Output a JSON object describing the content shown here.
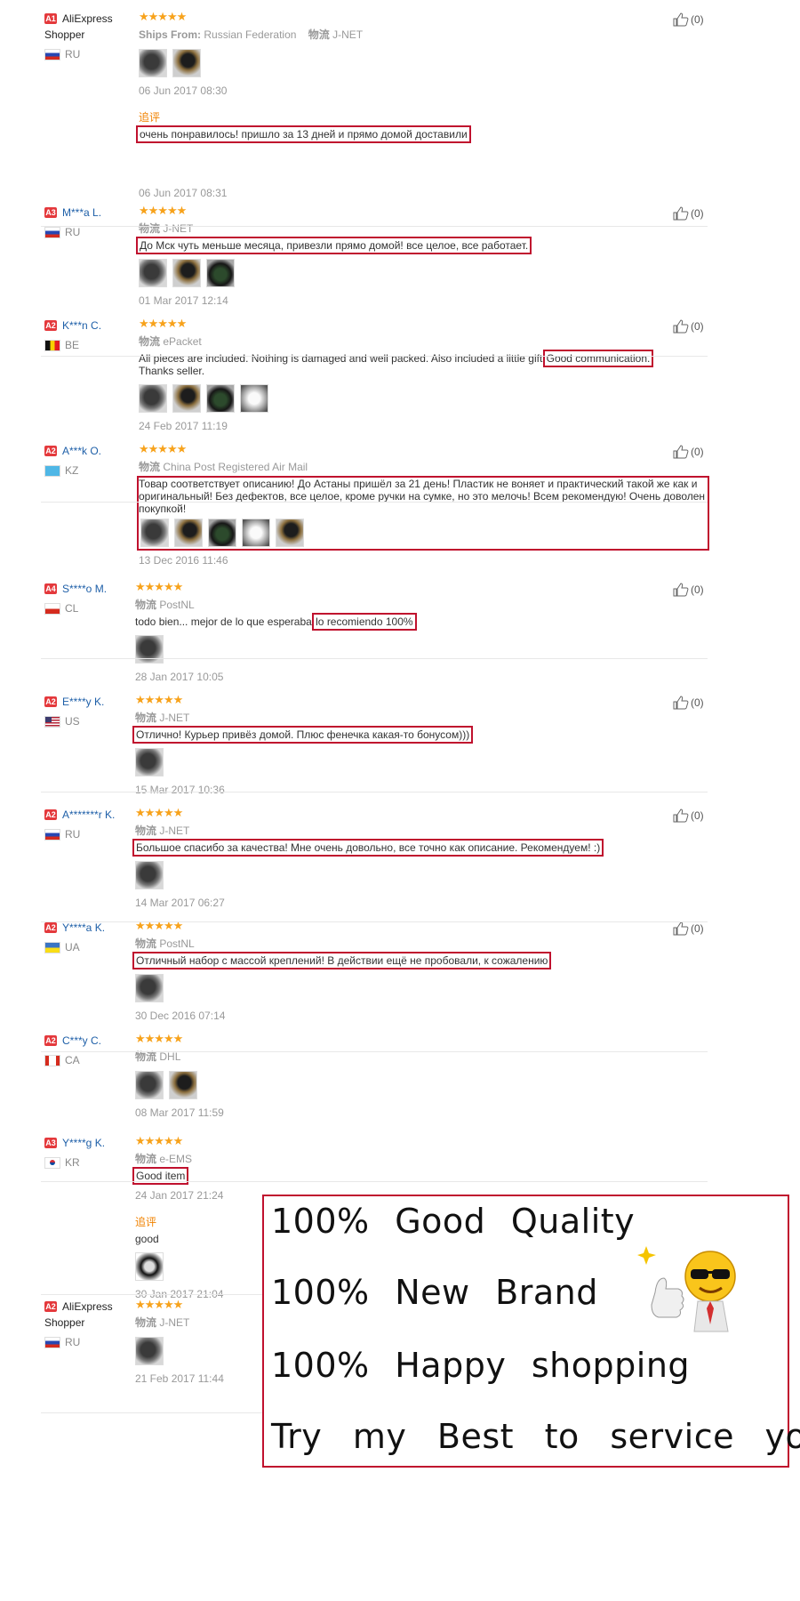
{
  "reviews": [
    {
      "level": "A1",
      "name": "AliExpress Shopper",
      "shopper": true,
      "country": "RU",
      "flag": "ru",
      "stars": "★★★★★",
      "ships_label": "Ships From:",
      "ships_value": "Russian Federation",
      "logistics_label": "物流",
      "logistics": "J-NET",
      "text": "",
      "text_boxed": "",
      "photos": 2,
      "date": "06 Jun 2017 08:30",
      "additional_label": "追评",
      "additional_text": "очень понравилось! пришло за 13 дней и прямо домой доставили",
      "additional_date": "06 Jun 2017 08:31",
      "likes": "(0)"
    },
    {
      "level": "A3",
      "name": "M***a L.",
      "country": "RU",
      "flag": "ru",
      "stars": "★★★★★",
      "logistics_label": "物流",
      "logistics": "J-NET",
      "text": "",
      "text_boxed": "До Мск чуть меньше месяца, привезли прямо домой! все целое, все работает.",
      "photos": 3,
      "date": "01 Mar 2017 12:14",
      "likes": "(0)"
    },
    {
      "level": "A2",
      "name": "K***n C.",
      "country": "BE",
      "flag": "be",
      "stars": "★★★★★",
      "logistics_label": "物流",
      "logistics": "ePacket",
      "text": "All pieces are included. Nothing is damaged and well packed. Also included a little gift.",
      "text_boxed": "Good communication.",
      "text_after": "Thanks seller.",
      "photos": 4,
      "date": "24 Feb 2017 11:19",
      "likes": "(0)"
    },
    {
      "level": "A2",
      "name": "A***k O.",
      "country": "KZ",
      "flag": "kz",
      "stars": "★★★★★",
      "logistics_label": "物流",
      "logistics": "China Post Registered Air Mail",
      "text": "",
      "text_boxed": "Товар соответствует описанию! До Астаны пришёл за 21 день! Пластик не воняет и практический такой же как и оригинальный! Без дефектов, все целое, кроме ручки на сумке, но это мелочь! Всем рекомендую! Очень доволен покупкой!",
      "photos": 5,
      "date": "13 Dec 2016 11:46",
      "likes": "(0)"
    },
    {
      "level": "A4",
      "name": "S****o M.",
      "country": "CL",
      "flag": "cl",
      "stars": "★★★★★",
      "logistics_label": "物流",
      "logistics": "PostNL",
      "text": "todo bien... mejor de lo que esperaba,",
      "text_boxed": "lo recomiendo 100%",
      "photos": 1,
      "date": "28 Jan 2017 10:05",
      "likes": "(0)"
    },
    {
      "level": "A2",
      "name": "E****y K.",
      "country": "US",
      "flag": "us",
      "stars": "★★★★★",
      "logistics_label": "物流",
      "logistics": "J-NET",
      "text": "",
      "text_boxed": "Отлично! Курьер привёз домой. Плюс фенечка какая-то бонусом)))",
      "photos": 1,
      "date": "15 Mar 2017 10:36",
      "likes": "(0)"
    },
    {
      "level": "A2",
      "name": "A*******r K.",
      "country": "RU",
      "flag": "ru",
      "stars": "★★★★★",
      "logistics_label": "物流",
      "logistics": "J-NET",
      "text": "",
      "text_boxed": "Большое спасибо за качества! Мне очень довольно, все точно как описание. Рекомендуем! :)",
      "photos": 1,
      "date": "14 Mar 2017 06:27",
      "likes": "(0)"
    },
    {
      "level": "A2",
      "name": "Y****a K.",
      "country": "UA",
      "flag": "ua",
      "stars": "★★★★★",
      "logistics_label": "物流",
      "logistics": "PostNL",
      "text": "",
      "text_boxed": "Отличный набор с массой креплений! В действии ещё не пробовали, к сожалению",
      "photos": 1,
      "date": "30 Dec 2016 07:14",
      "likes": "(0)"
    },
    {
      "level": "A2",
      "name": "C***y C.",
      "country": "CA",
      "flag": "ca",
      "stars": "★★★★★",
      "logistics_label": "物流",
      "logistics": "DHL",
      "text": "",
      "text_boxed": "",
      "photos": 2,
      "date": "08 Mar 2017 11:59"
    },
    {
      "level": "A3",
      "name": "Y****g K.",
      "country": "KR",
      "flag": "kr",
      "stars": "★★★★★",
      "logistics_label": "物流",
      "logistics": "e-EMS",
      "text": "",
      "text_boxed": "Good item",
      "photos": 0,
      "date": "24 Jan 2017 21:24",
      "additional_label": "追评",
      "additional_text": "good",
      "additional_photos": 1,
      "additional_date": "30 Jan 2017 21:04"
    },
    {
      "level": "A2",
      "name": "AliExpress Shopper",
      "shopper": true,
      "country": "RU",
      "flag": "ru",
      "stars": "★★★★★",
      "logistics_label": "物流",
      "logistics": "J-NET",
      "text": "",
      "text_boxed": "",
      "photos": 1,
      "date": "21 Feb 2017 11:44"
    }
  ],
  "promo": {
    "lines": [
      "100% Good Quality",
      "100% New Brand",
      "100% Happy shopping",
      "Try my Best to service you"
    ]
  },
  "colors": {
    "highlight_box": "#c0112e",
    "stars": "#f7a21b",
    "name_link": "#1e5fa8",
    "addl_label": "#f08200"
  }
}
